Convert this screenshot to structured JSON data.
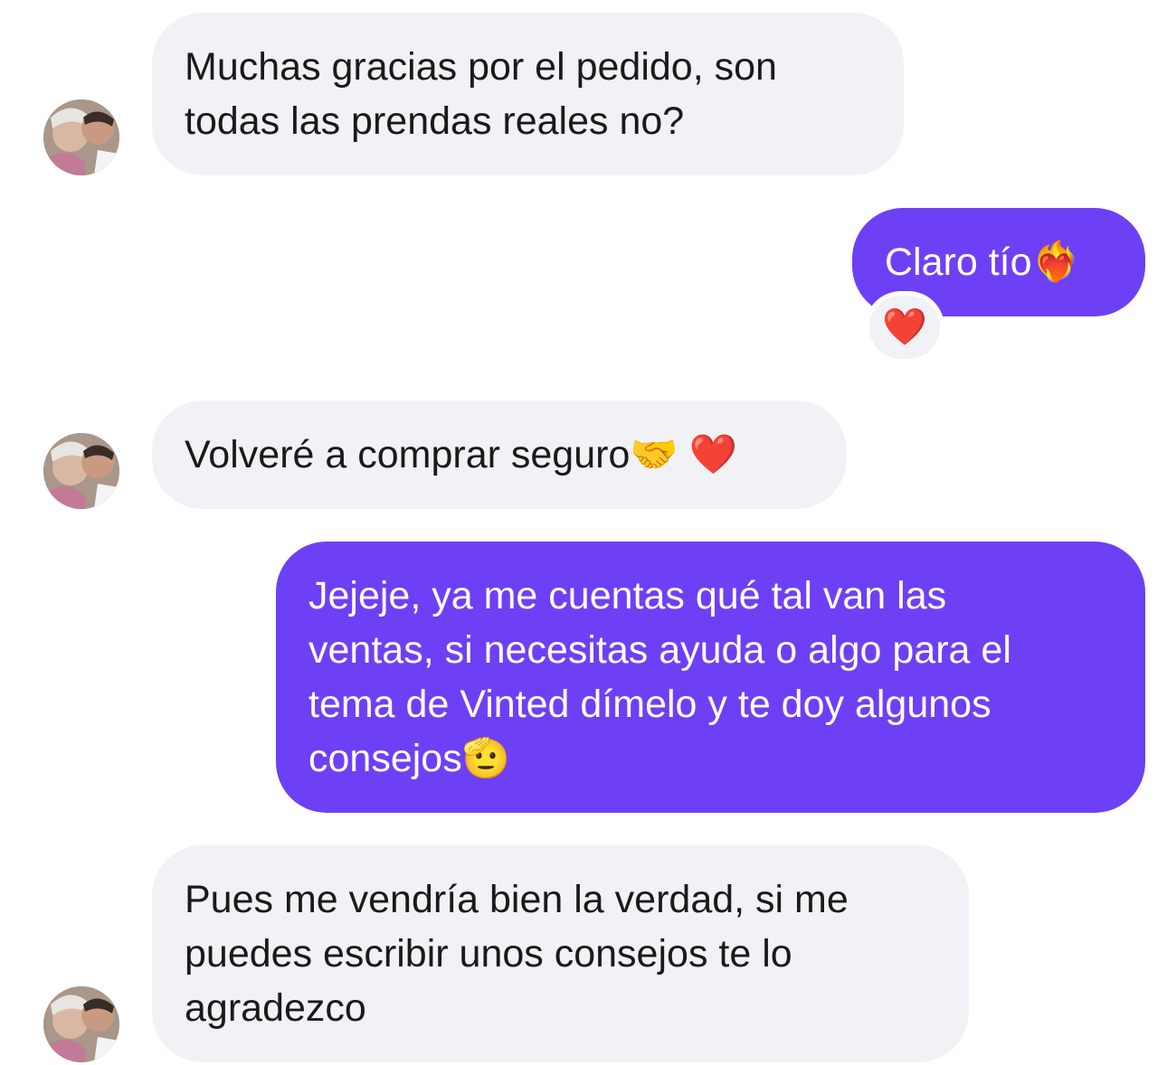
{
  "messages": [
    {
      "side": "in",
      "text": "Muchas gracias por el pedido, son\ntodas las prendas reales no?"
    },
    {
      "side": "out",
      "text": "Claro tío❤️‍🔥",
      "reaction": "❤️"
    },
    {
      "side": "in",
      "text": "Volveré a comprar seguro🤝 ❤️"
    },
    {
      "side": "out",
      "text": "Jejeje, ya me cuentas qué tal van las\nventas, si necesitas ayuda o algo para el\ntema de Vinted dímelo y te doy algunos\nconsejos🫡"
    },
    {
      "side": "in",
      "text": "Pues me vendría bien la verdad, si me\npuedes escribir unos consejos te lo\nagradezco"
    }
  ],
  "colors": {
    "incoming_bubble": "#f1f2f5",
    "outgoing_bubble": "#6d40f5",
    "incoming_text": "#1a1a1a",
    "outgoing_text": "#ffffff"
  },
  "icons": {
    "avatar": "contact-photo-icon"
  }
}
